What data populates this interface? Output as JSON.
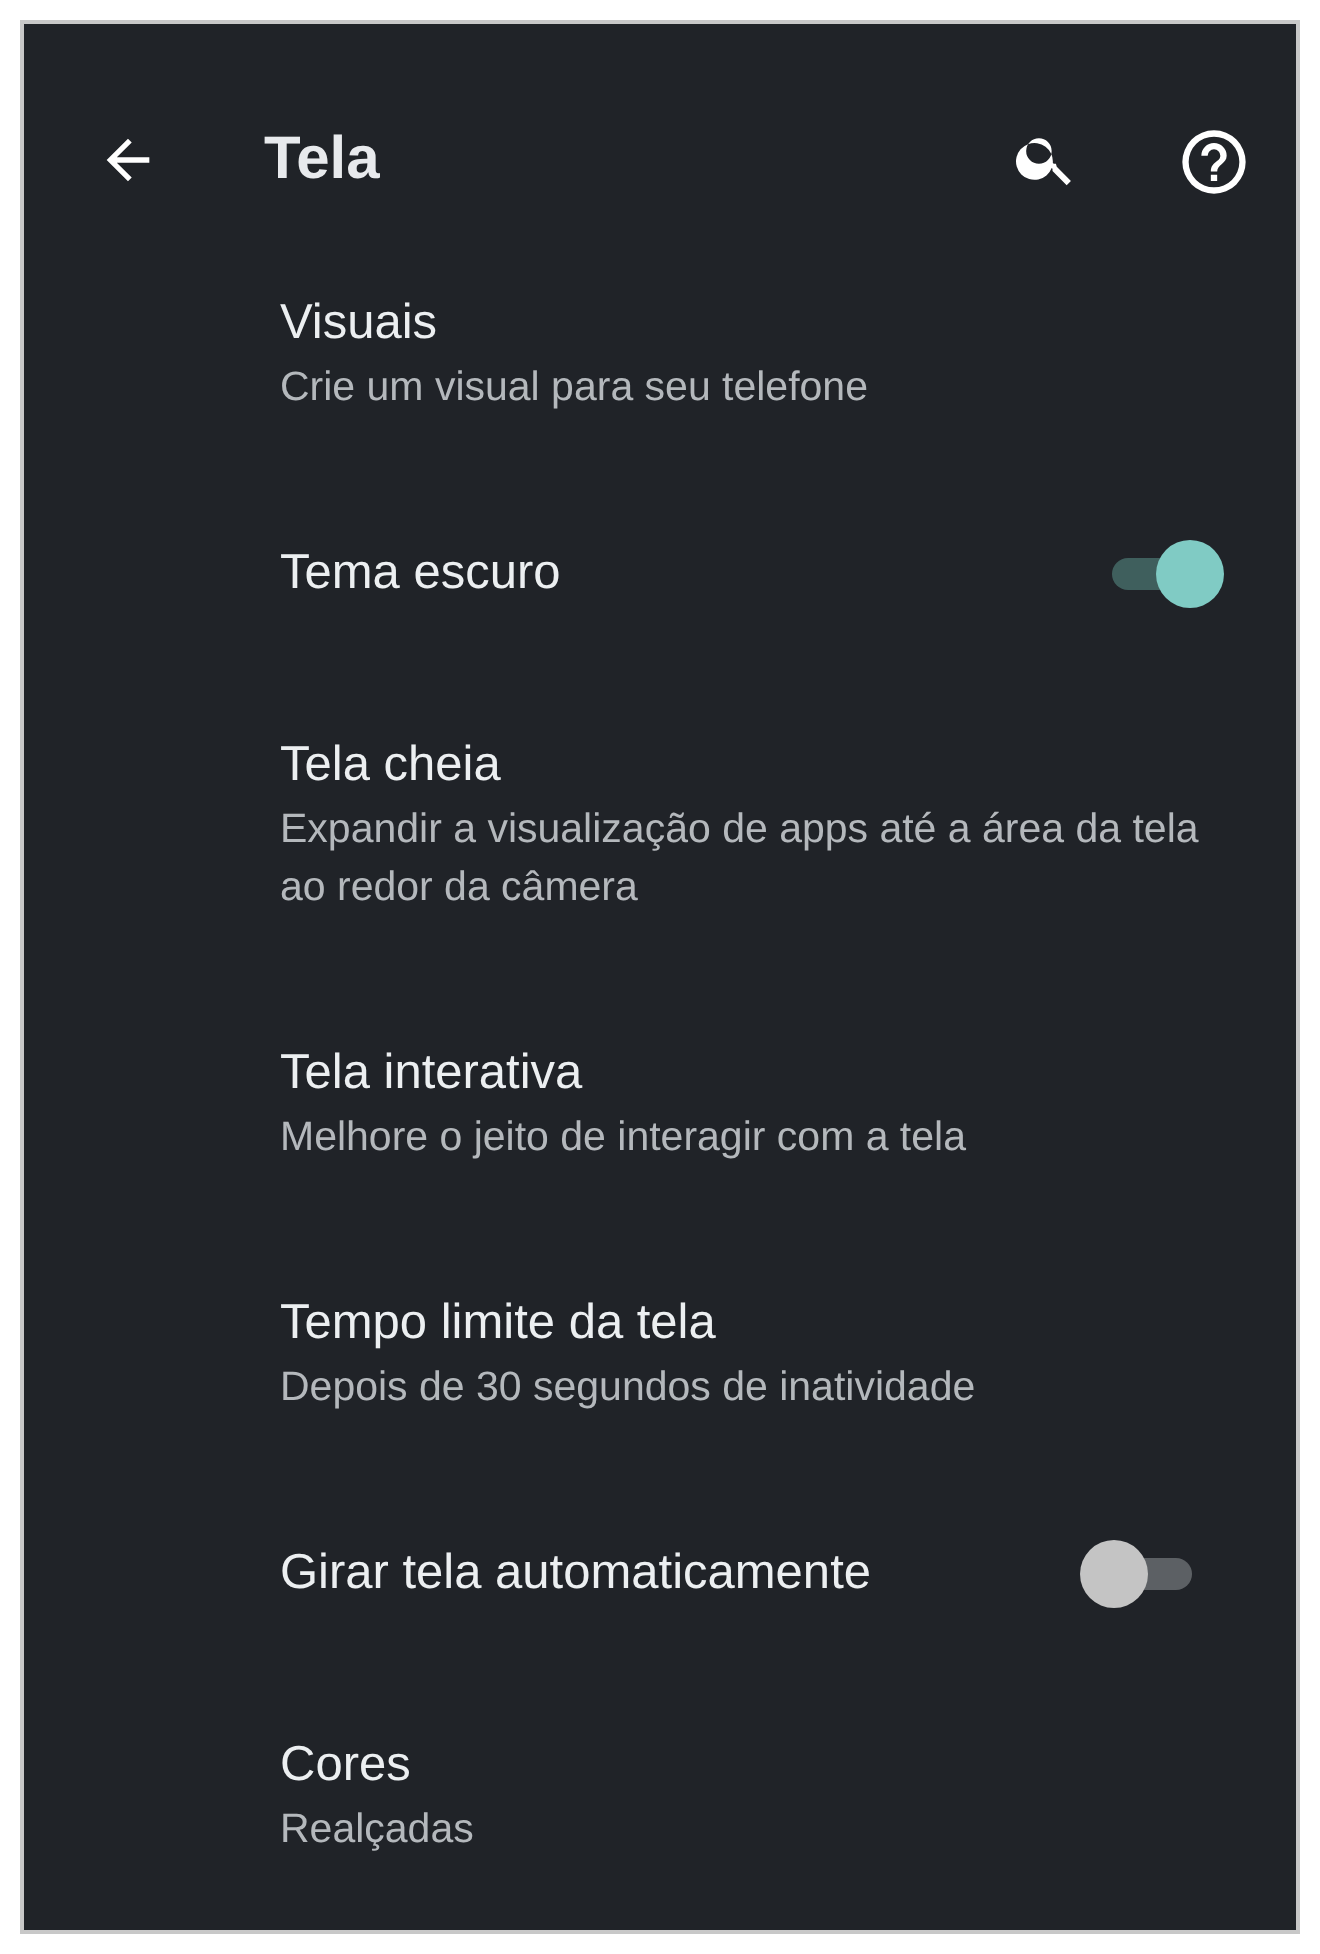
{
  "app_bar": {
    "title": "Tela"
  },
  "settings": [
    {
      "kind": "link",
      "title": "Visuais",
      "summary": "Crie um visual para seu telefone"
    },
    {
      "kind": "switch",
      "title": "Tema escuro",
      "on": true
    },
    {
      "kind": "link",
      "title": "Tela cheia",
      "summary": "Expandir a visualização de apps até a área da tela ao redor da câmera"
    },
    {
      "kind": "link",
      "title": "Tela interativa",
      "summary": "Melhore o jeito de interagir com a tela"
    },
    {
      "kind": "link",
      "title": "Tempo limite da tela",
      "summary": "Depois de 30 segundos de inatividade"
    },
    {
      "kind": "switch",
      "title": "Girar tela automaticamente",
      "on": false
    },
    {
      "kind": "link",
      "title": "Cores",
      "summary": "Realçadas"
    }
  ]
}
